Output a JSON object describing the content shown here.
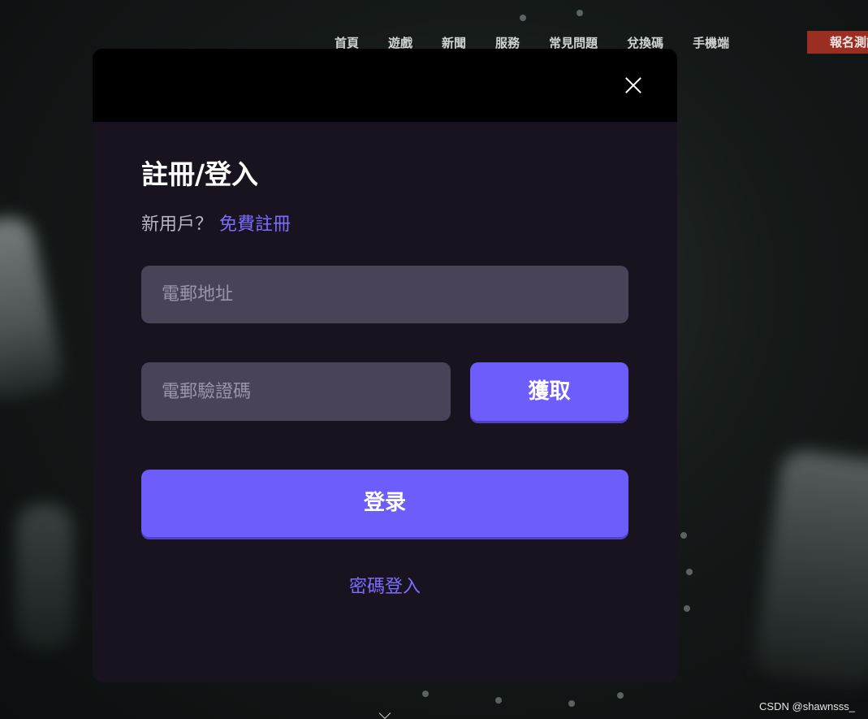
{
  "nav": {
    "items": [
      {
        "label": "首頁"
      },
      {
        "label": "遊戲"
      },
      {
        "label": "新聞"
      },
      {
        "label": "服務"
      },
      {
        "label": "常見問題"
      },
      {
        "label": "兌換碼"
      },
      {
        "label": "手機端"
      }
    ],
    "signup_label": "報名測試"
  },
  "modal": {
    "title": "註冊/登入",
    "new_user_prompt": "新用戶？",
    "register_link": "免費註冊",
    "email_placeholder": "電郵地址",
    "code_placeholder": "電郵驗證碼",
    "get_code_label": "獲取",
    "login_label": "登录",
    "password_login_link": "密碼登入"
  },
  "watermark": "CSDN @shawnsss_",
  "colors": {
    "accent": "#6d5efc",
    "link": "#7c6cff",
    "modal_bg": "#18131f",
    "input_bg": "#4a4257",
    "signup_bg": "#9b2e23"
  }
}
